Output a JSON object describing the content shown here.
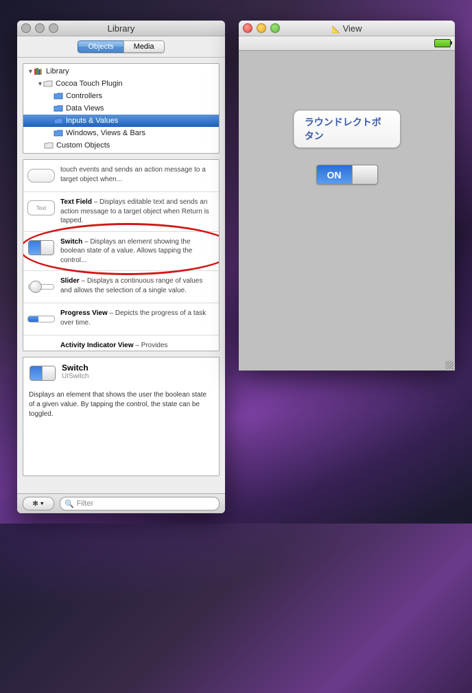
{
  "library": {
    "title": "Library",
    "tabs": {
      "objects": "Objects",
      "media": "Media"
    },
    "tree": {
      "root": "Library",
      "plugin": "Cocoa Touch Plugin",
      "items": [
        "Controllers",
        "Data Views",
        "Inputs & Values",
        "Windows, Views & Bars"
      ],
      "custom": "Custom Objects"
    },
    "items": {
      "button_desc": "touch events and sends an action message to a target object when...",
      "textfield_name": "Text Field",
      "textfield_desc": " – Displays editable text and sends an action message to a target object when Return is tapped.",
      "textfield_icon": "Text",
      "switch_name": "Switch",
      "switch_desc": " – Displays an element showing the boolean state of a value. Allows tapping the control...",
      "slider_name": "Slider",
      "slider_desc": " – Displays a continuous range of values and allows the selection of a single value.",
      "progress_name": "Progress View",
      "progress_desc": " – Depicts the progress of a task over time.",
      "activity_name": "Activity Indicator View",
      "activity_desc": " – Provides"
    },
    "detail": {
      "title": "Switch",
      "class": "UISwitch",
      "desc": "Displays an element that shows the user the boolean state of a given value.  By tapping the control, the state can be toggled."
    },
    "search_placeholder": "Filter",
    "gear_label": "✻▾"
  },
  "view": {
    "title": "View",
    "button_label": "ラウンドレクトボタン",
    "switch_label": "ON"
  }
}
